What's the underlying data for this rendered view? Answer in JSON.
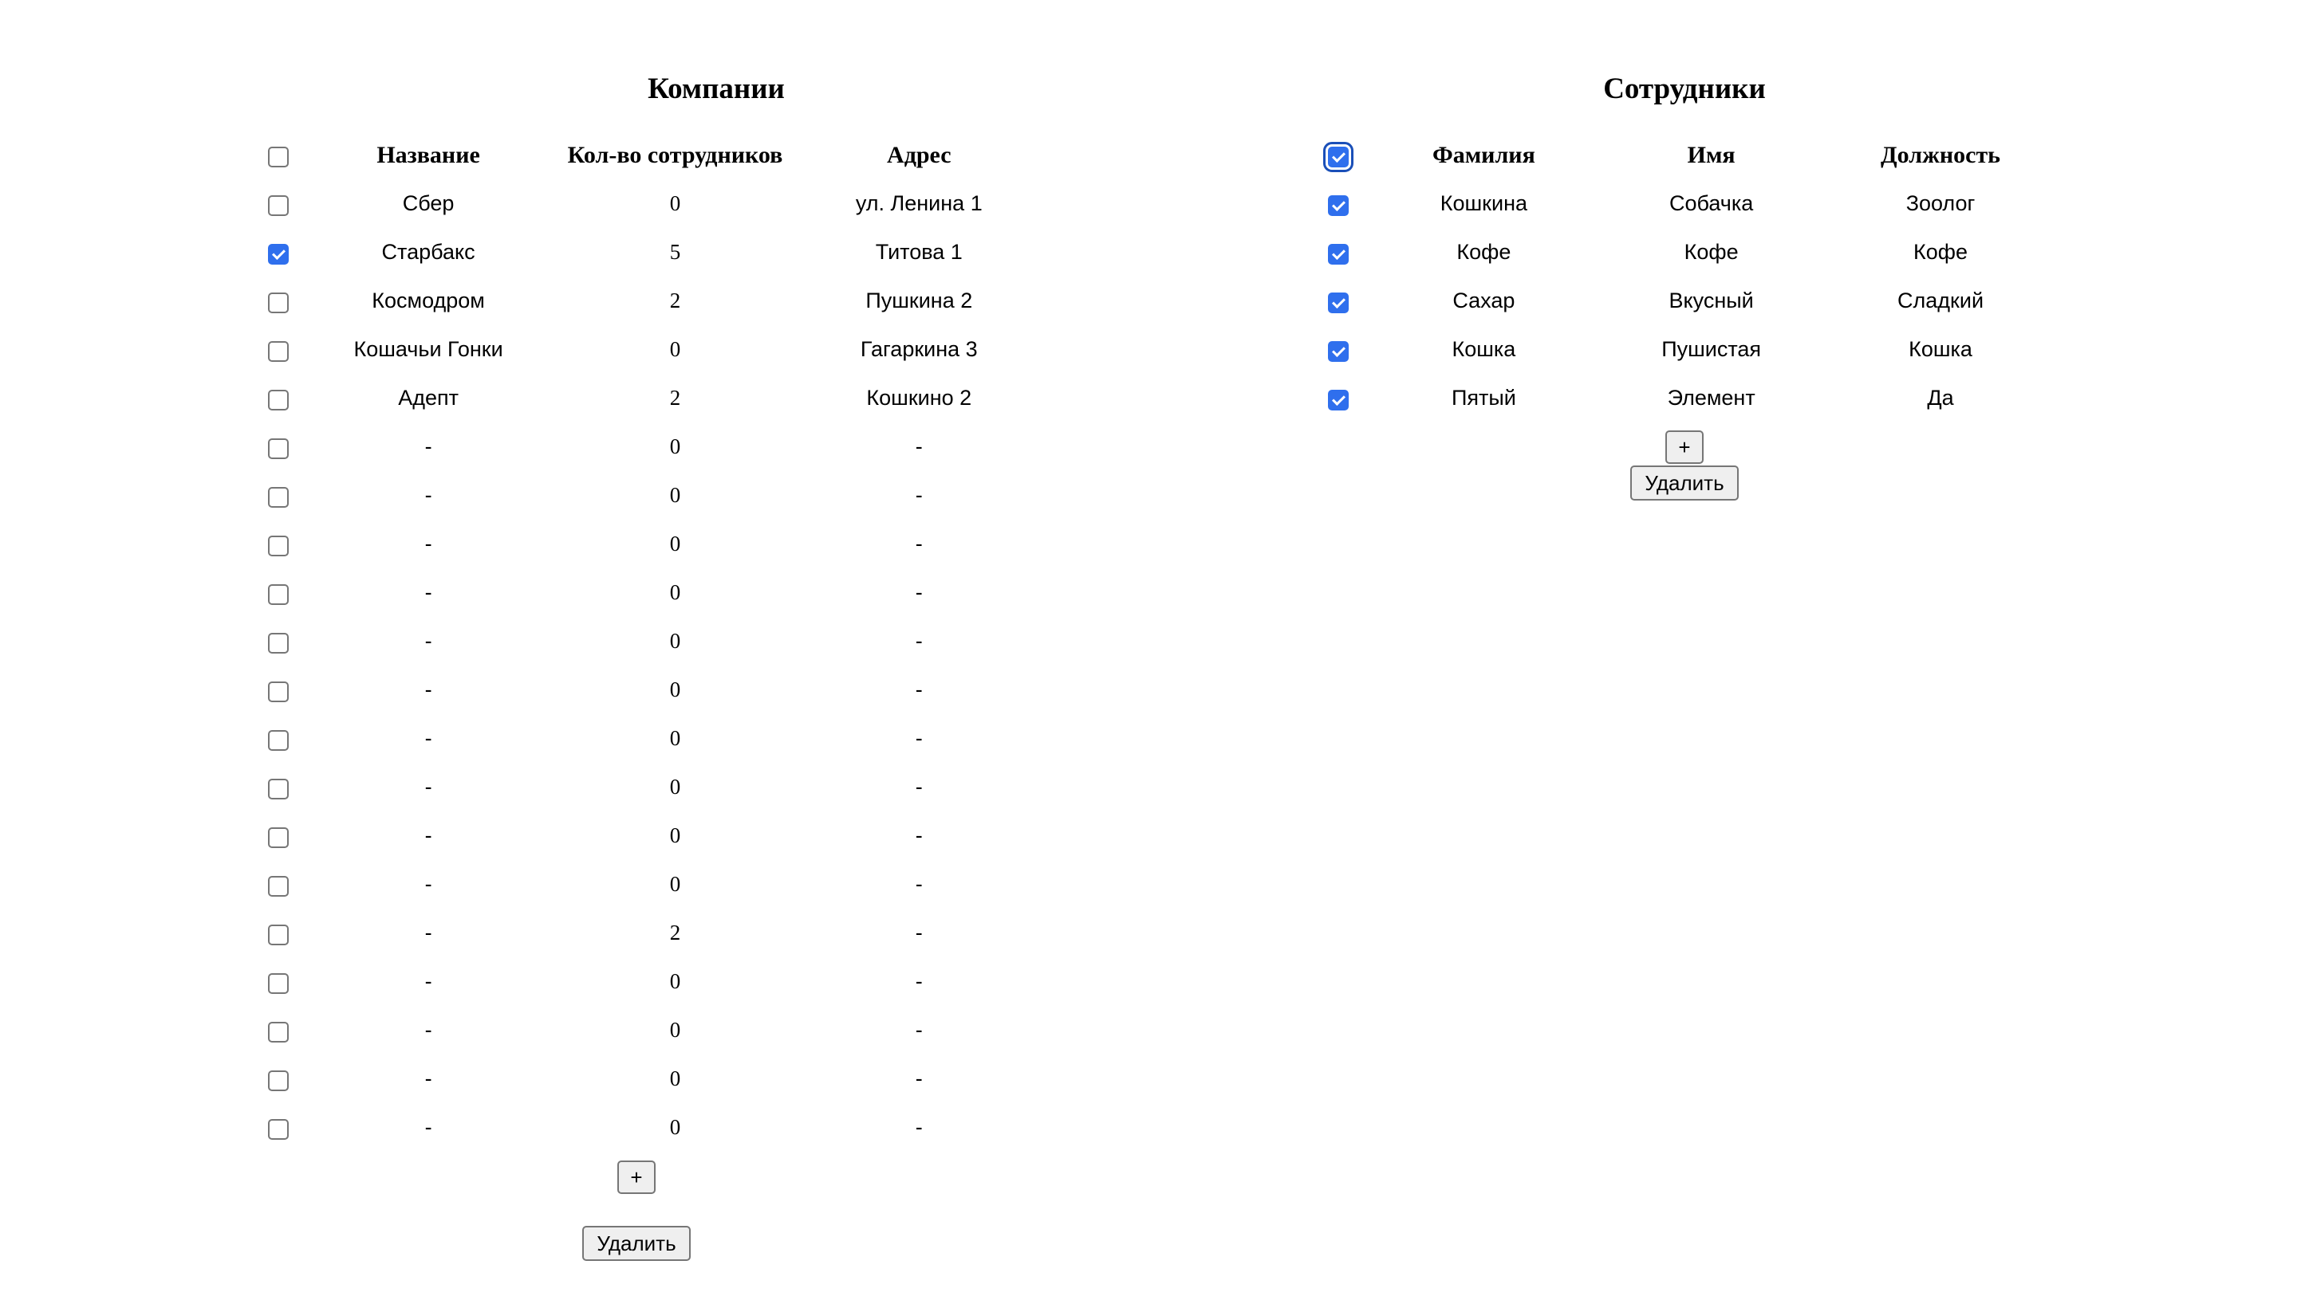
{
  "companies": {
    "title": "Компании",
    "headers": {
      "name": "Название",
      "count": "Кол-во сотрудников",
      "address": "Адрес"
    },
    "select_all_checked": false,
    "rows": [
      {
        "checked": false,
        "name": "Сбер",
        "count": "0",
        "address": "ул. Ленина 1"
      },
      {
        "checked": true,
        "name": "Старбакс",
        "count": "5",
        "address": "Титова 1"
      },
      {
        "checked": false,
        "name": "Космодром",
        "count": "2",
        "address": "Пушкина 2"
      },
      {
        "checked": false,
        "name": "Кошачьи Гонки",
        "count": "0",
        "address": "Гагаркина 3"
      },
      {
        "checked": false,
        "name": "Адепт",
        "count": "2",
        "address": "Кошкино 2"
      },
      {
        "checked": false,
        "name": "-",
        "count": "0",
        "address": "-"
      },
      {
        "checked": false,
        "name": "-",
        "count": "0",
        "address": "-"
      },
      {
        "checked": false,
        "name": "-",
        "count": "0",
        "address": "-"
      },
      {
        "checked": false,
        "name": "-",
        "count": "0",
        "address": "-"
      },
      {
        "checked": false,
        "name": "-",
        "count": "0",
        "address": "-"
      },
      {
        "checked": false,
        "name": "-",
        "count": "0",
        "address": "-"
      },
      {
        "checked": false,
        "name": "-",
        "count": "0",
        "address": "-"
      },
      {
        "checked": false,
        "name": "-",
        "count": "0",
        "address": "-"
      },
      {
        "checked": false,
        "name": "-",
        "count": "0",
        "address": "-"
      },
      {
        "checked": false,
        "name": "-",
        "count": "0",
        "address": "-"
      },
      {
        "checked": false,
        "name": "-",
        "count": "2",
        "address": "-"
      },
      {
        "checked": false,
        "name": "-",
        "count": "0",
        "address": "-"
      },
      {
        "checked": false,
        "name": "-",
        "count": "0",
        "address": "-"
      },
      {
        "checked": false,
        "name": "-",
        "count": "0",
        "address": "-"
      },
      {
        "checked": false,
        "name": "-",
        "count": "0",
        "address": "-"
      }
    ],
    "add_label": "+",
    "delete_label": "Удалить"
  },
  "employees": {
    "title": "Сотрудники",
    "headers": {
      "last_name": "Фамилия",
      "first_name": "Имя",
      "position": "Должность"
    },
    "select_all_checked": true,
    "rows": [
      {
        "checked": true,
        "last_name": "Кошкина",
        "first_name": "Собачка",
        "position": "Зоолог"
      },
      {
        "checked": true,
        "last_name": "Кофе",
        "first_name": "Кофе",
        "position": "Кофе"
      },
      {
        "checked": true,
        "last_name": "Сахар",
        "first_name": "Вкусный",
        "position": "Сладкий"
      },
      {
        "checked": true,
        "last_name": "Кошка",
        "first_name": "Пушистая",
        "position": "Кошка"
      },
      {
        "checked": true,
        "last_name": "Пятый",
        "first_name": "Элемент",
        "position": "Да"
      }
    ],
    "add_label": "+",
    "delete_label": "Удалить"
  }
}
